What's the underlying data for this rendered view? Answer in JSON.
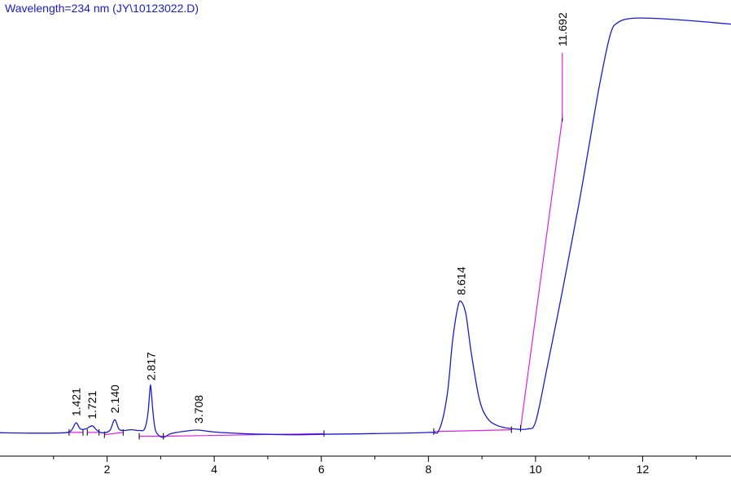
{
  "chart_data": {
    "type": "line",
    "title": "Wavelength=234 nm (JY\\10123022.D)",
    "xlabel": "",
    "ylabel": "",
    "xlim": [
      0.0,
      13.65
    ],
    "x_ticks": [
      2,
      4,
      6,
      8,
      10,
      12
    ],
    "x_tick_labels": [
      "2",
      "4",
      "6",
      "8",
      "10",
      "12"
    ],
    "grid": false,
    "legend": "none",
    "colors": {
      "trace": "#1a1ad0",
      "baseline": "#e020e0",
      "axis": "#000000",
      "title": "#1a1ad0"
    },
    "series": [
      {
        "points": [
          [
            0.0,
            0.012
          ],
          [
            0.6,
            0.011
          ],
          [
            1.2,
            0.012
          ],
          [
            1.33,
            0.018
          ],
          [
            1.42,
            0.038
          ],
          [
            1.5,
            0.022
          ],
          [
            1.6,
            0.022
          ],
          [
            1.72,
            0.03
          ],
          [
            1.8,
            0.02
          ],
          [
            1.9,
            0.012
          ],
          [
            2.05,
            0.018
          ],
          [
            2.14,
            0.046
          ],
          [
            2.22,
            0.022
          ],
          [
            2.3,
            0.018
          ],
          [
            2.45,
            0.02
          ],
          [
            2.6,
            0.018
          ],
          [
            2.7,
            0.022
          ],
          [
            2.76,
            0.06
          ],
          [
            2.8,
            0.125
          ],
          [
            2.817,
            0.131
          ],
          [
            2.86,
            0.06
          ],
          [
            2.9,
            0.02
          ],
          [
            2.96,
            0.006
          ],
          [
            3.05,
            0.0
          ],
          [
            3.2,
            0.01
          ],
          [
            3.5,
            0.017
          ],
          [
            3.708,
            0.019
          ],
          [
            4.0,
            0.014
          ],
          [
            4.5,
            0.01
          ],
          [
            5.0,
            0.008
          ],
          [
            5.5,
            0.007
          ],
          [
            6.0,
            0.008
          ],
          [
            7.0,
            0.01
          ],
          [
            8.0,
            0.013
          ],
          [
            8.2,
            0.02
          ],
          [
            8.35,
            0.11
          ],
          [
            8.45,
            0.25
          ],
          [
            8.55,
            0.34
          ],
          [
            8.614,
            0.353
          ],
          [
            8.7,
            0.32
          ],
          [
            8.8,
            0.22
          ],
          [
            8.95,
            0.1
          ],
          [
            9.1,
            0.05
          ],
          [
            9.3,
            0.03
          ],
          [
            9.6,
            0.022
          ],
          [
            9.85,
            0.022
          ],
          [
            10.0,
            0.04
          ],
          [
            10.2,
            0.17
          ],
          [
            10.5,
            0.38
          ],
          [
            10.8,
            0.6
          ],
          [
            11.0,
            0.76
          ],
          [
            11.2,
            0.92
          ],
          [
            11.4,
            1.05
          ],
          [
            11.55,
            1.08
          ],
          [
            11.8,
            1.09
          ],
          [
            12.2,
            1.09
          ],
          [
            12.8,
            1.085
          ],
          [
            13.65,
            1.075
          ]
        ]
      }
    ],
    "baseline_segments": [
      [
        [
          1.29,
          0.013
        ],
        [
          1.55,
          0.013
        ]
      ],
      [
        [
          1.63,
          0.013
        ],
        [
          1.85,
          0.013
        ]
      ],
      [
        [
          1.95,
          0.007
        ],
        [
          2.3,
          0.013
        ]
      ],
      [
        [
          2.6,
          0.003
        ],
        [
          3.05,
          0.003
        ],
        [
          6.05,
          0.01
        ]
      ],
      [
        [
          8.1,
          0.015
        ],
        [
          9.55,
          0.02
        ]
      ],
      [
        [
          9.72,
          0.023
        ],
        [
          10.5,
          0.83
        ]
      ]
    ],
    "peak_marker_line": [
      [
        10.5,
        0.83
      ],
      [
        10.5,
        1.0
      ]
    ],
    "peak_labels": [
      {
        "label": "1.421",
        "x": 1.421,
        "y": 0.038
      },
      {
        "label": "1.721",
        "x": 1.721,
        "y": 0.03
      },
      {
        "label": "2.140",
        "x": 2.14,
        "y": 0.046
      },
      {
        "label": "2.817",
        "x": 2.817,
        "y": 0.131
      },
      {
        "label": "3.708",
        "x": 3.708,
        "y": 0.019
      },
      {
        "label": "8.614",
        "x": 8.614,
        "y": 0.353
      },
      {
        "label": "11.692",
        "x": 10.5,
        "y": 1.0
      }
    ]
  }
}
